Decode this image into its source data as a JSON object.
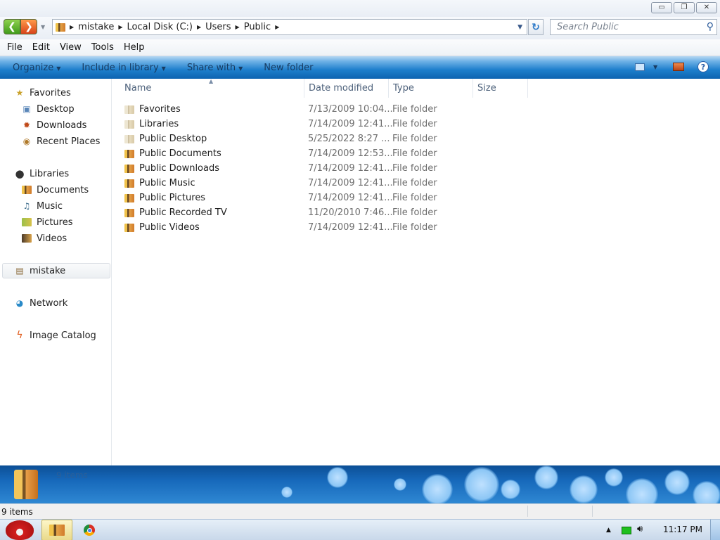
{
  "window": {
    "buttons": {
      "minimize": "▭",
      "maximize": "❐",
      "close": "✕"
    }
  },
  "address": {
    "crumbs": [
      "mistake",
      "Local Disk (C:)",
      "Users",
      "Public"
    ],
    "search_placeholder": "Search Public"
  },
  "menu": [
    "File",
    "Edit",
    "View",
    "Tools",
    "Help"
  ],
  "commands": [
    "Organize",
    "Include in library",
    "Share with",
    "New folder"
  ],
  "nav": {
    "favorites": {
      "label": "Favorites",
      "items": [
        "Desktop",
        "Downloads",
        "Recent Places"
      ]
    },
    "libraries": {
      "label": "Libraries",
      "items": [
        "Documents",
        "Music",
        "Pictures",
        "Videos"
      ]
    },
    "computer": "mistake",
    "network": "Network",
    "catalog": "Image Catalog"
  },
  "columns": [
    "Name",
    "Date modified",
    "Type",
    "Size"
  ],
  "files": [
    {
      "name": "Favorites",
      "date": "7/13/2009 10:04...",
      "type": "File folder"
    },
    {
      "name": "Libraries",
      "date": "7/14/2009 12:41...",
      "type": "File folder"
    },
    {
      "name": "Public Desktop",
      "date": "5/25/2022 8:27 ...",
      "type": "File folder"
    },
    {
      "name": "Public Documents",
      "date": "7/14/2009 12:53...",
      "type": "File folder"
    },
    {
      "name": "Public Downloads",
      "date": "7/14/2009 12:41...",
      "type": "File folder"
    },
    {
      "name": "Public Music",
      "date": "7/14/2009 12:41...",
      "type": "File folder"
    },
    {
      "name": "Public Pictures",
      "date": "7/14/2009 12:41...",
      "type": "File folder"
    },
    {
      "name": "Public Recorded TV",
      "date": "11/20/2010 7:46...",
      "type": "File folder"
    },
    {
      "name": "Public Videos",
      "date": "7/14/2009 12:41...",
      "type": "File folder"
    }
  ],
  "details": {
    "count": "9 items"
  },
  "status": {
    "count": "9 items"
  },
  "taskbar": {
    "clock": "11:17 PM"
  },
  "colors": {
    "command_bar": "#1e7fcc",
    "details_pane": "#1769bb",
    "header_text": "#4c607a"
  }
}
